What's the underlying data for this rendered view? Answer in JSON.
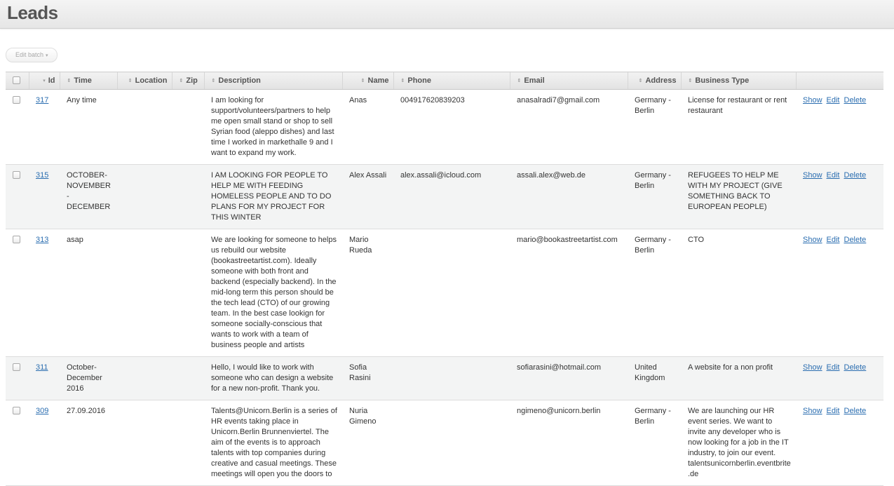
{
  "header": {
    "title": "Leads"
  },
  "toolbar": {
    "batch_label": "Edit batch",
    "batch_caret": "▾"
  },
  "table": {
    "columns": {
      "id": "Id",
      "time": "Time",
      "location": "Location",
      "zip": "Zip",
      "description": "Description",
      "name": "Name",
      "phone": "Phone",
      "email": "Email",
      "address": "Address",
      "business_type": "Business Type"
    },
    "sort_icon": "⇕",
    "sort_active_icon": "▾",
    "actions": {
      "show": "Show",
      "edit": "Edit",
      "delete": "Delete"
    },
    "rows": [
      {
        "id": "317",
        "time": "Any time",
        "location": "",
        "zip": "",
        "description": "I am looking for support/volunteers/partners to help me open small stand or shop to sell Syrian food (aleppo dishes) and last time I worked in markethalle 9 and I want to expand my work.",
        "name": "Anas",
        "phone": "004917620839203",
        "email": "anasalradi7@gmail.com",
        "address": "Germany - Berlin",
        "business_type": "License for restaurant or rent restaurant"
      },
      {
        "id": "315",
        "time": "OCTOBER-NOVEMBER - DECEMBER",
        "location": "",
        "zip": "",
        "description": "I AM LOOKING FOR PEOPLE TO HELP ME WITH FEEDING HOMELESS PEOPLE AND TO DO PLANS FOR MY PROJECT FOR THIS WINTER",
        "name": "Alex Assali",
        "phone": "alex.assali@icloud.com",
        "email": "assali.alex@web.de",
        "address": "Germany - Berlin",
        "business_type": "REFUGEES TO HELP ME WITH MY PROJECT (GIVE SOMETHING BACK TO EUROPEAN PEOPLE)"
      },
      {
        "id": "313",
        "time": "asap",
        "location": "",
        "zip": "",
        "description": "We are looking for someone to helps us rebuild our website (bookastreetartist.com). Ideally someone with both front and backend (especially backend). In the mid-long term this person should be the tech lead (CTO) of our growing team. In the best case lookign for someone socially-conscious that wants to work with a team of business people and artists",
        "name": "Mario Rueda",
        "phone": "",
        "email": "mario@bookastreetartist.com",
        "address": "Germany - Berlin",
        "business_type": "CTO"
      },
      {
        "id": "311",
        "time": "October-December 2016",
        "location": "",
        "zip": "",
        "description": "Hello, I would like to work with someone who can design a website for a new non-profit. Thank you.",
        "name": "Sofia Rasini",
        "phone": "",
        "email": "sofiarasini@hotmail.com",
        "address": "United Kingdom",
        "business_type": "A website for a non profit"
      },
      {
        "id": "309",
        "time": "27.09.2016",
        "location": "",
        "zip": "",
        "description": "Talents@Unicorn.Berlin is a series of HR events taking place in Unicorn.Berlin Brunnenviertel. The aim of the events is to approach talents with top companies during creative and casual meetings. These meetings will open you the doors to",
        "name": "Nuria Gimeno",
        "phone": "",
        "email": "ngimeno@unicorn.berlin",
        "address": "Germany - Berlin",
        "business_type": "We are launching our HR event series. We want to invite any developer who is now looking for a job in the IT industry, to join our event. talentsunicornberlin.eventbrite.de"
      }
    ]
  }
}
